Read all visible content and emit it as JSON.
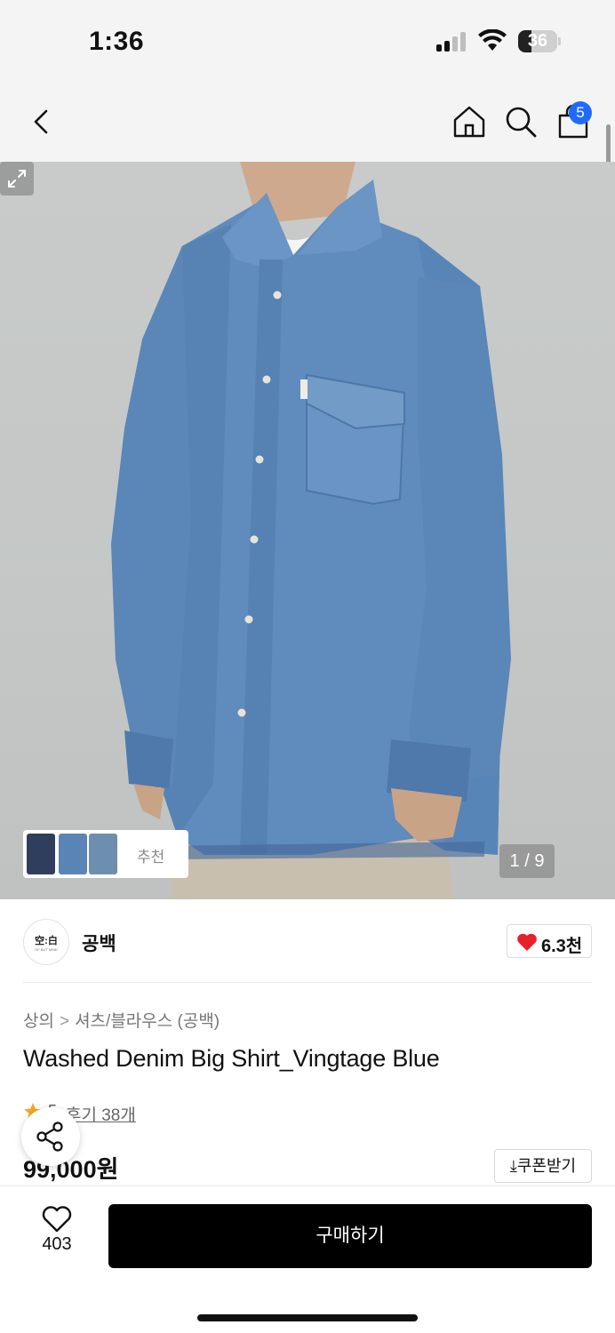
{
  "status_bar": {
    "time": "1:36",
    "battery": "36"
  },
  "nav": {
    "back_icon": "chevron-left-icon",
    "home_icon": "home-icon",
    "search_icon": "search-icon",
    "cart_icon": "shopping-bag-icon",
    "cart_count": "5"
  },
  "gallery": {
    "current_page": "1 / 9",
    "related_label": "추천"
  },
  "brand": {
    "logo_text": "空:白",
    "logo_subtext": "OF BUT MINE",
    "name": "공백",
    "likes": "6.3천"
  },
  "product": {
    "breadcrumb": [
      "상의",
      "셔츠/블라우스 (공백)"
    ],
    "breadcrumb_separator": ">",
    "title": "Washed Denim Big Shirt_Vingtage Blue",
    "rating": "5",
    "review_link": "후기 38개",
    "price": "99,000원",
    "coupon_label": "⤓쿠폰받기"
  },
  "bottom_bar": {
    "wish_count": "403",
    "buy_label": "구매하기"
  },
  "colors": {
    "accent_badge": "#1f6bff",
    "heart_red": "#e8202a",
    "star_orange": "#f5a623",
    "buy_button": "#000000"
  }
}
